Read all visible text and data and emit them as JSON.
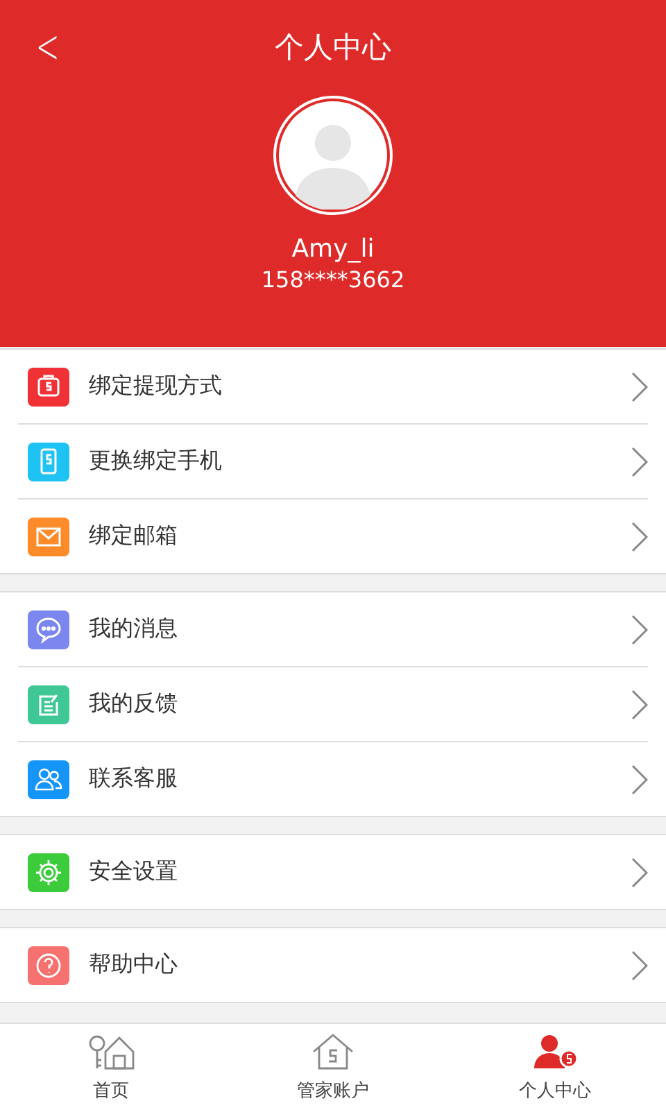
{
  "header": {
    "back": "<",
    "title": "个人中心",
    "username": "Amy_li",
    "phone": "158****3662"
  },
  "groups": [
    {
      "items": [
        {
          "label": "绑定提现方式",
          "color": "#f03237"
        },
        {
          "label": "更换绑定手机",
          "color": "#1fc3f3"
        },
        {
          "label": "绑定邮箱",
          "color": "#fd8b29"
        }
      ]
    },
    {
      "items": [
        {
          "label": "我的消息",
          "color": "#7b87ee"
        },
        {
          "label": "我的反馈",
          "color": "#3fc795"
        },
        {
          "label": "联系客服",
          "color": "#1595f8"
        }
      ]
    },
    {
      "items": [
        {
          "label": "安全设置",
          "color": "#3bcb3b"
        }
      ]
    },
    {
      "items": [
        {
          "label": "帮助中心",
          "color": "#f57270"
        }
      ]
    }
  ],
  "tabs": [
    {
      "label": "首页",
      "selected": false
    },
    {
      "label": "管家账户",
      "selected": false
    },
    {
      "label": "个人中心",
      "selected": true
    }
  ]
}
